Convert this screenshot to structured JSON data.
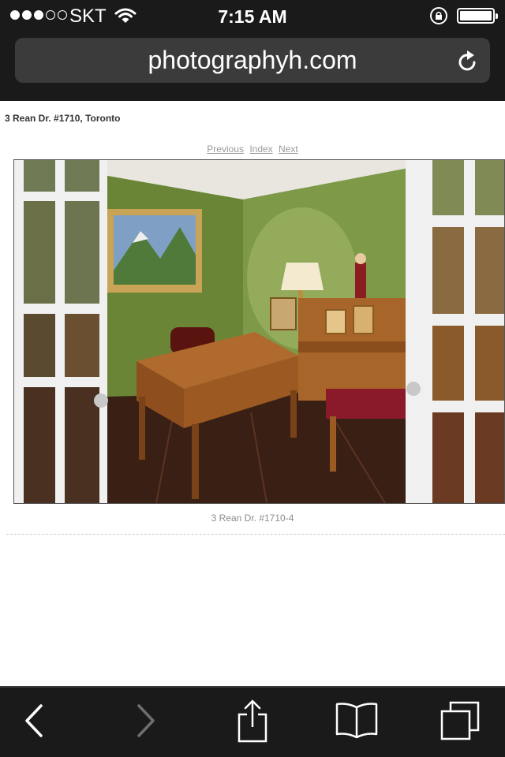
{
  "status_bar": {
    "carrier": "SKT",
    "time": "7:15 AM",
    "signal_strength": 3,
    "signal_max": 5,
    "icons": [
      "wifi-icon",
      "rotation-lock-icon",
      "battery-icon"
    ]
  },
  "browser": {
    "url": "photographyh.com",
    "icons": [
      "reload-icon"
    ]
  },
  "page": {
    "title": "3 Rean Dr. #1710, Toronto",
    "pager": {
      "previous": "Previous",
      "index": "Index",
      "next": "Next"
    },
    "photo_caption": "3 Rean Dr. #1710-4"
  },
  "toolbar": {
    "icons": [
      "back-arrow-icon",
      "forward-arrow-icon",
      "share-icon",
      "bookmarks-icon",
      "tabs-icon"
    ],
    "forward_enabled": false
  },
  "colors": {
    "chrome": "#1a1a1a",
    "address_field": "#3b3b3b",
    "link": "#9a9a9a"
  }
}
